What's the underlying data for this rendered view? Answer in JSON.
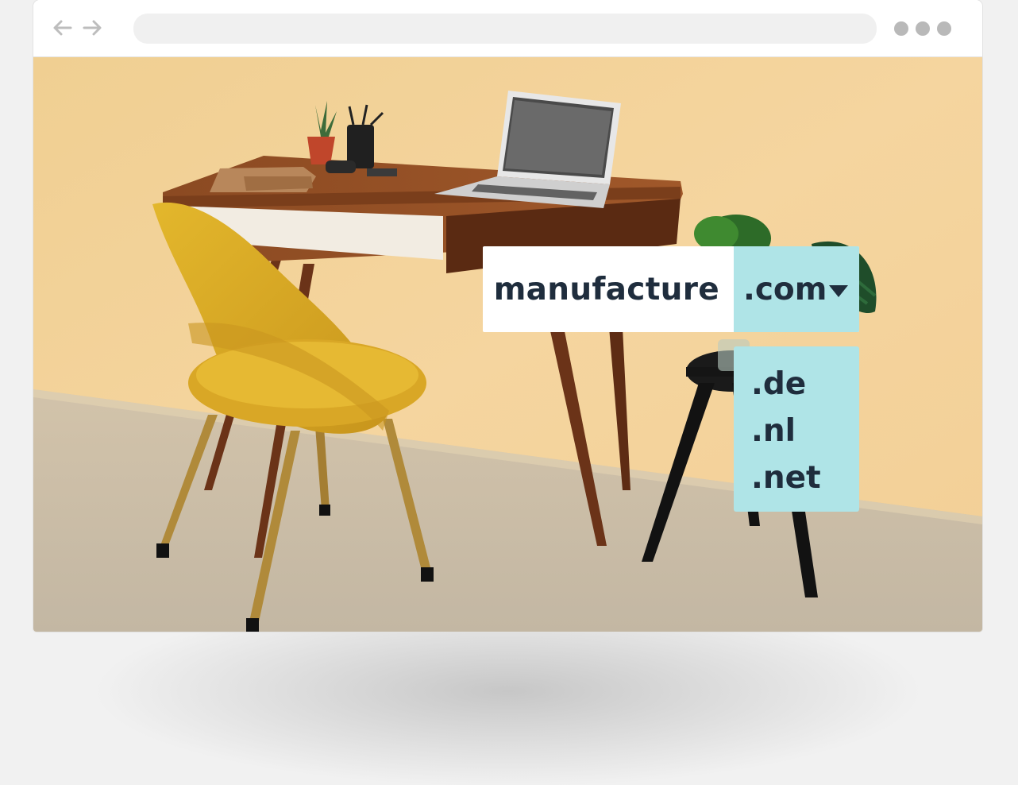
{
  "browser": {
    "address": ""
  },
  "domain_search": {
    "name": "manufacture",
    "selected_tld": ".com",
    "options": [
      ".de",
      ".nl",
      ".net"
    ],
    "colors": {
      "accent": "#afe4e7",
      "text": "#1f2d3d"
    }
  },
  "icons": {
    "back": "arrow-left-icon",
    "forward": "arrow-right-icon",
    "menu": "more-dots-icon",
    "dropdown": "caret-down-icon"
  }
}
